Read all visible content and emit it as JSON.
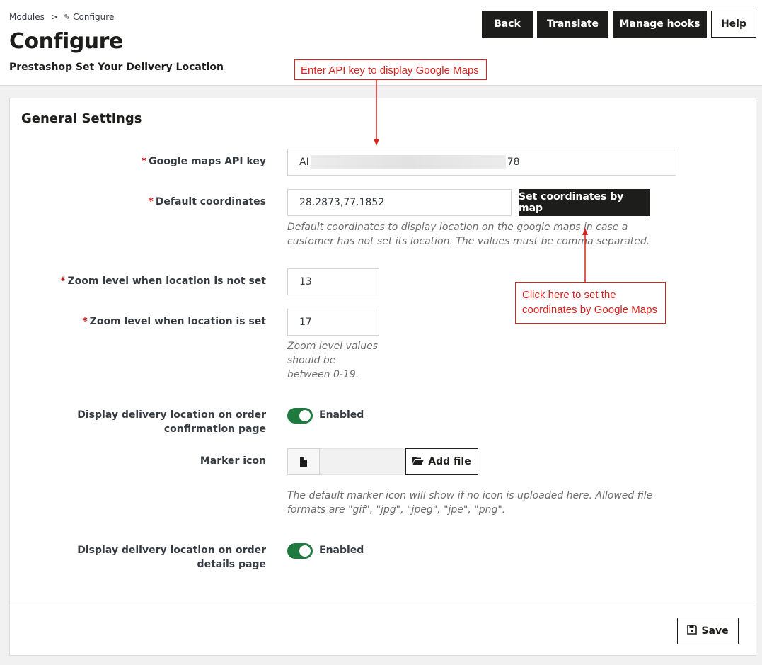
{
  "header": {
    "breadcrumb": {
      "parent": "Modules",
      "separator": ">",
      "current": "Configure"
    },
    "title": "Configure",
    "subtitle": "Prestashop Set Your Delivery Location",
    "toolbar": {
      "back": "Back",
      "translate": "Translate",
      "manage_hooks": "Manage hooks",
      "help": "Help"
    }
  },
  "panel": {
    "title": "General Settings",
    "required_mark": "*",
    "api_key": {
      "label": "Google maps API key",
      "value_start": "AI",
      "value_end": "78"
    },
    "default_coordinates": {
      "label": "Default coordinates",
      "value": "28.2873,77.1852",
      "button": "Set coordinates by map",
      "help": "Default coordinates to display location on the google maps in case a customer has not set its location. The values must be comma separated."
    },
    "zoom_not_set": {
      "label": "Zoom level when location is not set",
      "value": "13"
    },
    "zoom_set": {
      "label": "Zoom level when location is set",
      "value": "17",
      "help": "Zoom level values should be between 0-19."
    },
    "confirmation_page": {
      "label": "Display delivery location on order confirmation page",
      "state": "Enabled"
    },
    "marker_icon": {
      "label": "Marker icon",
      "button": "Add file",
      "help": "The default marker icon will show if no icon is uploaded here. Allowed file formats are \"gif\", \"jpg\", \"jpeg\", \"jpe\", \"png\"."
    },
    "details_page": {
      "label": "Display delivery location on order details page",
      "state": "Enabled"
    },
    "save": "Save"
  },
  "annotations": {
    "api_key_note": "Enter API key to display Google Maps",
    "map_button_note": "Click here to set the coordinates by Google Maps"
  },
  "colors": {
    "accent_dark": "#1d1d1b",
    "toggle_on": "#1f7a3f",
    "required": "#c0161c",
    "annotation": "#d9231e"
  }
}
